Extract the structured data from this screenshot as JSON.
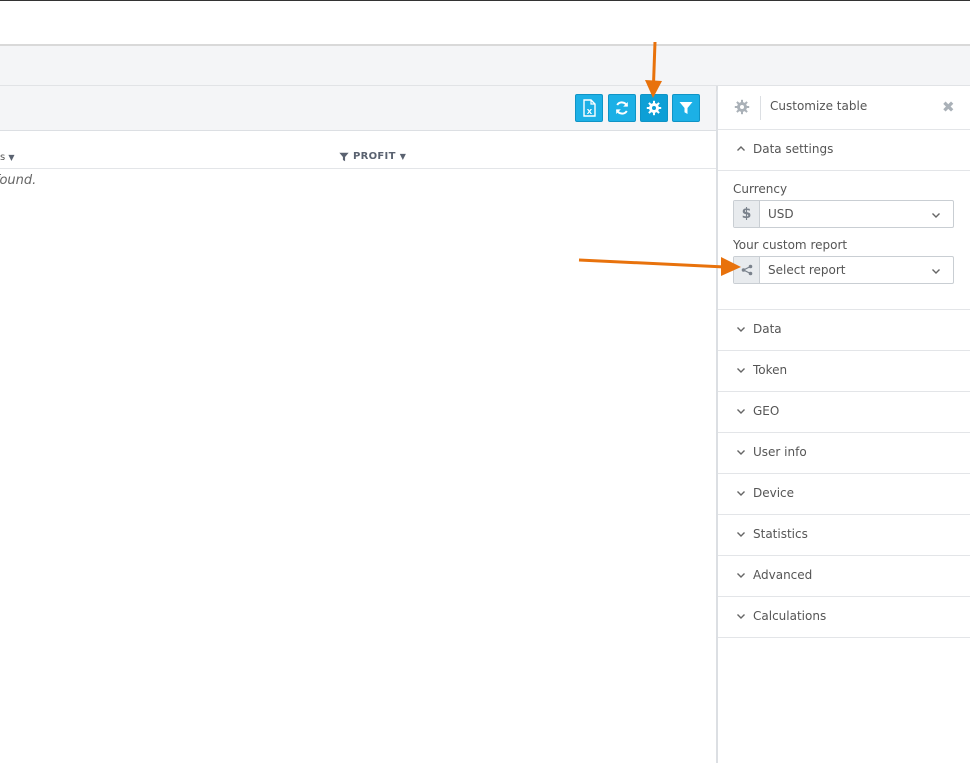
{
  "toolbar": {
    "buttons": [
      {
        "name": "export-excel-button",
        "icon": "excel-icon"
      },
      {
        "name": "refresh-button",
        "icon": "refresh-icon"
      },
      {
        "name": "settings-button",
        "icon": "gear-icon"
      },
      {
        "name": "filter-button",
        "icon": "filter-icon"
      }
    ]
  },
  "table": {
    "left_col_fragment": "s",
    "profit_header": "PROFIT",
    "empty_message": "s found."
  },
  "panel": {
    "title": "Customize table",
    "data_settings": {
      "title": "Data settings",
      "currency_label": "Currency",
      "currency_symbol": "$",
      "currency_value": "USD",
      "report_label": "Your custom report",
      "report_placeholder": "Select report"
    },
    "sections": [
      "Data",
      "Token",
      "GEO",
      "User info",
      "Device",
      "Statistics",
      "Advanced",
      "Calculations"
    ]
  },
  "colors": {
    "accent": "#1cb0e6",
    "annotation_arrow": "#e8720c"
  }
}
